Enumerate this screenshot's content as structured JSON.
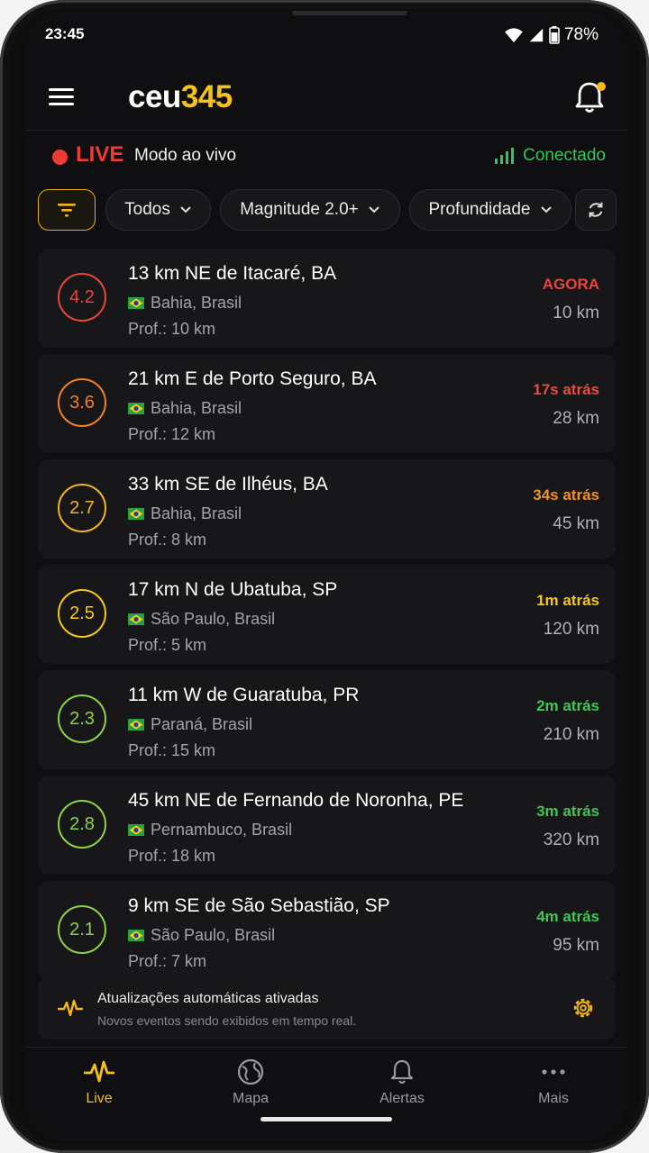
{
  "status": {
    "time": "23:45",
    "battery": "78%"
  },
  "app": {
    "logo_white": "ceu",
    "logo_yellow": "345"
  },
  "live": {
    "label": "LIVE",
    "mode": "Modo ao vivo",
    "connection": "Conectado"
  },
  "filters": {
    "all": "Todos",
    "magnitude": "Magnitude 2.0+",
    "depth": "Profundidade"
  },
  "events": [
    {
      "mag": "4.2",
      "title": "13 km NE de Itacaré, BA",
      "region": "Bahia, Brasil",
      "depth": "Prof.: 10 km",
      "time": "AGORA",
      "km": "10 km",
      "color": "#e8453c"
    },
    {
      "mag": "3.6",
      "title": "21 km E de Porto Seguro, BA",
      "region": "Bahia, Brasil",
      "depth": "Prof.: 12 km",
      "time": "17s atrás",
      "km": "28 km",
      "color": "#f0802a",
      "time_color": "#ee4a3c"
    },
    {
      "mag": "2.7",
      "title": "33 km SE de Ilhéus, BA",
      "region": "Bahia, Brasil",
      "depth": "Prof.: 8 km",
      "time": "34s atrás",
      "km": "45 km",
      "color": "#f2b32a",
      "time_color": "#f0902a"
    },
    {
      "mag": "2.5",
      "title": "17 km N de Ubatuba, SP",
      "region": "São Paulo, Brasil",
      "depth": "Prof.: 5 km",
      "time": "1m atrás",
      "km": "120 km",
      "color": "#f5c81d"
    },
    {
      "mag": "2.3",
      "title": "11 km W de Guaratuba, PR",
      "region": "Paraná, Brasil",
      "depth": "Prof.: 15 km",
      "time": "2m atrás",
      "km": "210 km",
      "color": "#8fd14a",
      "time_color": "#47c35a"
    },
    {
      "mag": "2.8",
      "title": "45 km NE de Fernando de Noronha, PE",
      "region": "Pernambuco, Brasil",
      "depth": "Prof.: 18 km",
      "time": "3m atrás",
      "km": "320 km",
      "color": "#8fd14a",
      "time_color": "#47c35a"
    },
    {
      "mag": "2.1",
      "title": "9 km SE de São Sebastião, SP",
      "region": "São Paulo, Brasil",
      "depth": "Prof.: 7 km",
      "time": "4m atrás",
      "km": "95 km",
      "color": "#8fd14a",
      "time_color": "#47c35a"
    }
  ],
  "banner": {
    "title": "Atualizações automáticas ativadas",
    "subtitle": "Novos eventos sendo exibidos em tempo real."
  },
  "nav": {
    "live": "Live",
    "map": "Mapa",
    "alerts": "Alertas",
    "more": "Mais"
  },
  "colors": {
    "accent": "#f5c21b",
    "live_red": "#ef3b34",
    "connected_green": "#35c45a"
  }
}
